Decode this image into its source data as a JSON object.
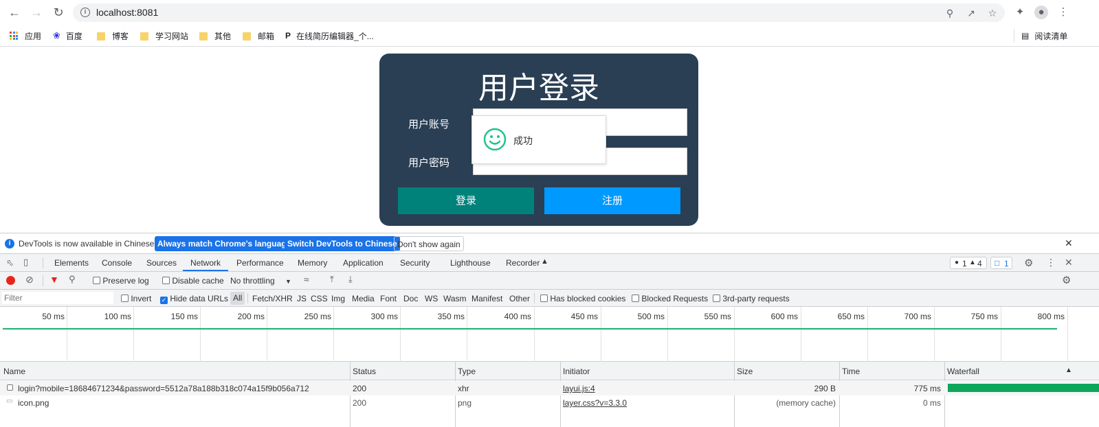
{
  "browser": {
    "url": "localhost:8081",
    "bookmarks": [
      {
        "label": "应用",
        "icon": "apps-grid-icon"
      },
      {
        "label": "百度",
        "icon": "baidu-paw-icon"
      },
      {
        "label": "博客",
        "icon": "folder-icon"
      },
      {
        "label": "学习网站",
        "icon": "folder-icon"
      },
      {
        "label": "其他",
        "icon": "folder-icon"
      },
      {
        "label": "邮箱",
        "icon": "folder-icon"
      },
      {
        "label": "在线简历编辑器_个...",
        "icon": "page-icon"
      }
    ],
    "reading_list": "阅读清单"
  },
  "page": {
    "title": "用户登录",
    "account_label": "用户账号",
    "password_label": "用户密码",
    "login_button": "登录",
    "register_button": "注册",
    "toast_text": "成功",
    "card_color": "#2a3f54",
    "login_color": "#00827b",
    "register_color": "#0099ff"
  },
  "devtools": {
    "infobar": {
      "message": "DevTools is now available in Chinese!",
      "btn_match": "Always match Chrome's language",
      "btn_switch": "Switch DevTools to Chinese",
      "btn_dismiss": "Don't show again"
    },
    "tabs": [
      "Elements",
      "Console",
      "Sources",
      "Network",
      "Performance",
      "Memory",
      "Application",
      "Security",
      "Lighthouse",
      "Recorder"
    ],
    "active_tab": "Network",
    "issue_counts": {
      "errors": "1",
      "warnings": "4",
      "messages": "1"
    },
    "toolbar": {
      "preserve_log": "Preserve log",
      "disable_cache": "Disable cache",
      "throttling": "No throttling"
    },
    "filter": {
      "placeholder": "Filter",
      "invert": "Invert",
      "hide_data_urls": "Hide data URLs",
      "types": [
        "All",
        "Fetch/XHR",
        "JS",
        "CSS",
        "Img",
        "Media",
        "Font",
        "Doc",
        "WS",
        "Wasm",
        "Manifest",
        "Other"
      ],
      "blocked_cookies": "Has blocked cookies",
      "blocked_requests": "Blocked Requests",
      "third_party": "3rd-party requests"
    },
    "timeline_ticks": [
      "50 ms",
      "100 ms",
      "150 ms",
      "200 ms",
      "250 ms",
      "300 ms",
      "350 ms",
      "400 ms",
      "450 ms",
      "500 ms",
      "550 ms",
      "600 ms",
      "650 ms",
      "700 ms",
      "750 ms",
      "800 ms"
    ],
    "columns": [
      "Name",
      "Status",
      "Type",
      "Initiator",
      "Size",
      "Time",
      "Waterfall"
    ],
    "rows": [
      {
        "name": "login?mobile=18684671234&password=5512a78a188b318c074a15f9b056a712",
        "status": "200",
        "type": "xhr",
        "initiator": "layui.js:4",
        "size": "290 B",
        "time": "775 ms"
      },
      {
        "name": "icon.png",
        "status": "200",
        "type": "png",
        "initiator": "layer.css?v=3.3.0",
        "size": "(memory cache)",
        "time": "0 ms"
      }
    ]
  }
}
